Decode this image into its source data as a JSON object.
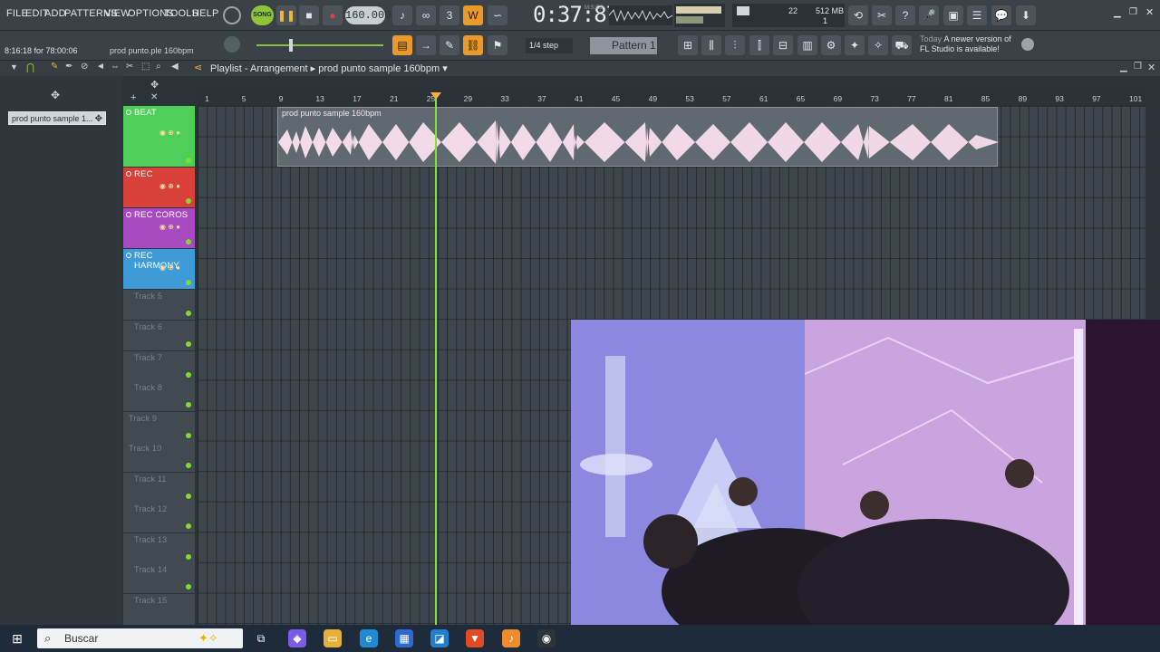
{
  "menu": [
    "FILE",
    "EDIT",
    "ADD",
    "PATTERNS",
    "VIEW",
    "OPTIONS",
    "TOOLS",
    "HELP"
  ],
  "transport": {
    "mode": "SONG",
    "tempo": "160.000",
    "time": "0:37:87",
    "time_unit": "M:S:CS"
  },
  "status": {
    "memory": "512 MB",
    "cpu_value": "22",
    "voices": "1"
  },
  "hint_left": "8:16:18 for 78:00:06",
  "hint_file": "prod punto.ple 160bpm",
  "snap": "1/4 step",
  "pattern": "Pattern 1",
  "news": {
    "date_label": "Today",
    "line1": "A newer version of",
    "line2": "FL Studio is available!"
  },
  "playlist": {
    "title": "Playlist - Arrangement",
    "subtitle": "prod punto sample 160bpm",
    "picker_item": "prod punto sample 1...",
    "clip_label": "prod punto sample 160bpm",
    "ruler_ticks": [
      "1",
      "5",
      "9",
      "13",
      "17",
      "21",
      "25",
      "29",
      "33",
      "37",
      "41",
      "45",
      "49",
      "53",
      "57",
      "61",
      "65",
      "69",
      "73",
      "77",
      "81",
      "85",
      "89",
      "93",
      "97",
      "101"
    ],
    "tracks": [
      {
        "name": "BEAT",
        "color": "#4fcf5a"
      },
      {
        "name": "REC",
        "color": "#d9403a"
      },
      {
        "name": "REC COROS",
        "color": "#a84bc0"
      },
      {
        "name": "REC HARMONY",
        "color": "#3f9bd8"
      },
      {
        "name": "Track 5"
      },
      {
        "name": "Track 6"
      },
      {
        "name": "Track 7"
      },
      {
        "name": "Track 8"
      },
      {
        "name": "Track 9"
      },
      {
        "name": "Track 10"
      },
      {
        "name": "Track 11"
      },
      {
        "name": "Track 12"
      },
      {
        "name": "Track 13"
      },
      {
        "name": "Track 14"
      },
      {
        "name": "Track 15"
      }
    ]
  },
  "taskbar": {
    "search_placeholder": "Buscar"
  }
}
